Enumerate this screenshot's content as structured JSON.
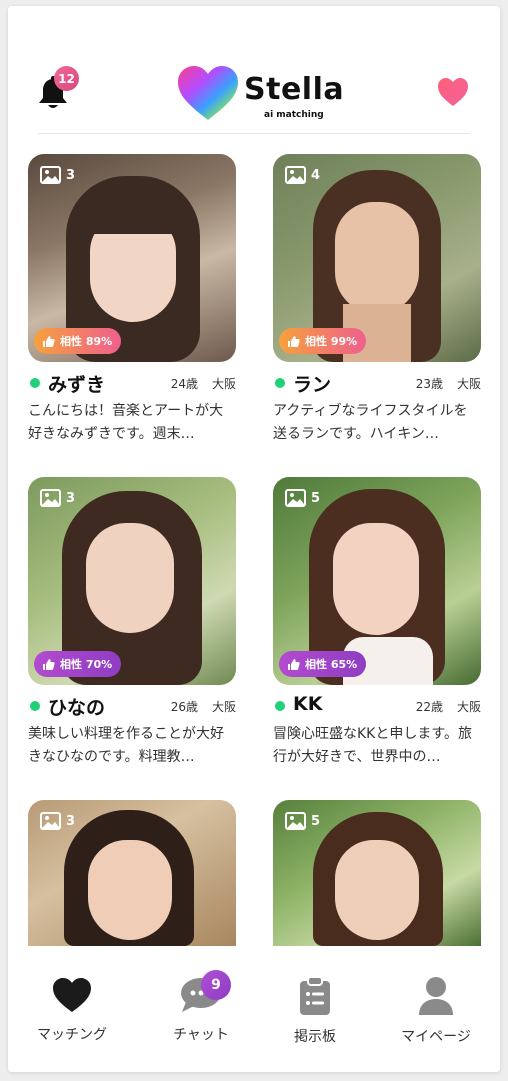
{
  "header": {
    "notification_count": "12",
    "logo_text": "Stella",
    "logo_subtitle": "ai matching",
    "icons": {
      "notification": "bell-icon",
      "favorites": "heart-icon"
    }
  },
  "colors": {
    "online": "#22d07a",
    "badge_pink": "#e85a8c",
    "badge_purple": "#9b44c8"
  },
  "profiles": [
    {
      "photos": "3",
      "compatibility": "相性 89%",
      "name": "みずき",
      "age": "24歳",
      "location": "大阪",
      "description": "こんにちは！音楽とアートが大好きなみずきです。週末…"
    },
    {
      "photos": "4",
      "compatibility": "相性 99%",
      "name": "ラン",
      "age": "23歳",
      "location": "大阪",
      "description": "アクティブなライフスタイルを送るランです。ハイキン…"
    },
    {
      "photos": "3",
      "compatibility": "相性 70%",
      "name": "ひなの",
      "age": "26歳",
      "location": "大阪",
      "description": "美味しい料理を作ることが大好きなひなのです。料理教…"
    },
    {
      "photos": "5",
      "compatibility": "相性 65%",
      "name": "KK",
      "age": "22歳",
      "location": "大阪",
      "description": "冒険心旺盛なKKと申します。旅行が大好きで、世界中の…"
    },
    {
      "photos": "3"
    },
    {
      "photos": "5"
    }
  ],
  "nav": {
    "matching": "マッチング",
    "chat": "チャット",
    "chat_badge": "9",
    "board": "掲示板",
    "mypage": "マイページ"
  }
}
